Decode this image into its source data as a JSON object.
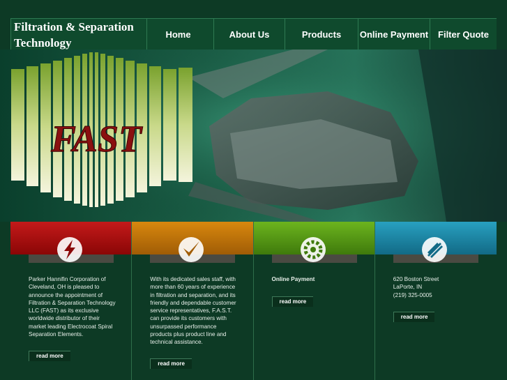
{
  "brand": {
    "line1": "Filtration & Separation",
    "line2": "Technology"
  },
  "nav": [
    {
      "label": "Home"
    },
    {
      "label": "About Us"
    },
    {
      "label": "Products"
    },
    {
      "label": "Online Payment"
    },
    {
      "label": "Filter Quote"
    }
  ],
  "hero": {
    "logo_text": "FAST"
  },
  "colors": {
    "background": "#0d3a25",
    "panel1": "#b01010",
    "panel2": "#c87a10",
    "panel3": "#5ea018",
    "panel4": "#1f8fb0"
  },
  "panels": [
    {
      "icon": "lightning-icon",
      "text": "Parker Hannifin Corporation of Cleveland, OH is pleased to announce the appointment of Filtration & Separation Technology LLC (FAST) as its exclusive worldwide distributor of their market leading Electrocoat Spiral Separation Elements.",
      "read_more": "read more"
    },
    {
      "icon": "checkmark-icon",
      "text": "With its dedicated sales staff, with more than 60 years of experience in filtration and separation, and its friendly and dependable customer service representatives, F.A.S.T. can provide its customers with unsurpassed performance products plus product line and technical assistance.",
      "read_more": "read more"
    },
    {
      "icon": "gear-icon",
      "text": "Online Payment",
      "read_more": "read more"
    },
    {
      "icon": "building-icon",
      "address1": "620 Boston Street",
      "address2": "LaPorte, IN",
      "phone": "(219) 325-0005",
      "read_more": "read more"
    }
  ]
}
